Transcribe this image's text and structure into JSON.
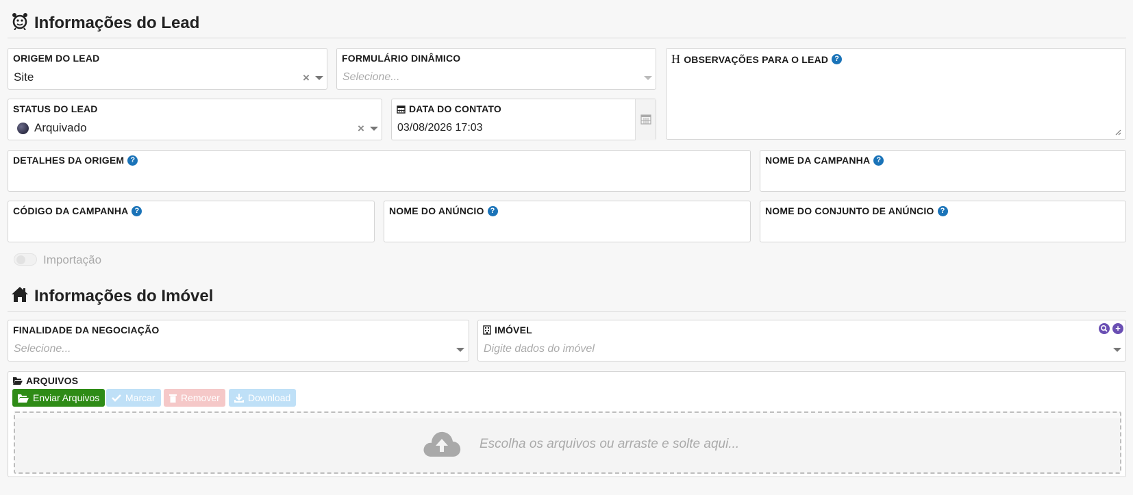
{
  "lead_section": {
    "title": "Informações do Lead",
    "origem": {
      "label": "ORIGEM DO LEAD",
      "value": "Site"
    },
    "formulario": {
      "label": "FORMULÁRIO DINÂMICO",
      "placeholder": "Selecione..."
    },
    "observacoes": {
      "label": "OBSERVAÇÕES PARA O LEAD",
      "prefix": "H"
    },
    "status": {
      "label": "STATUS DO LEAD",
      "value": "Arquivado"
    },
    "data_contato": {
      "label": "DATA DO CONTATO",
      "value": "03/08/2026 17:03"
    },
    "detalhes_origem": {
      "label": "DETALHES DA ORIGEM"
    },
    "nome_campanha": {
      "label": "NOME DA CAMPANHA"
    },
    "codigo_campanha": {
      "label": "CÓDIGO DA CAMPANHA"
    },
    "nome_anuncio": {
      "label": "NOME DO ANÚNCIO"
    },
    "nome_conjunto": {
      "label": "NOME DO CONJUNTO DE ANÚNCIO"
    },
    "importacao": {
      "label": "Importação",
      "checked": false
    }
  },
  "imovel_section": {
    "title": "Informações do Imóvel",
    "finalidade": {
      "label": "FINALIDADE DA NEGOCIAÇÃO",
      "placeholder": "Selecione..."
    },
    "imovel": {
      "label": "IMÓVEL",
      "placeholder": "Digite dados do imóvel"
    }
  },
  "arquivos": {
    "label": "ARQUIVOS",
    "buttons": {
      "enviar": "Enviar Arquivos",
      "marcar": "Marcar",
      "remover": "Remover",
      "download": "Download"
    },
    "dropzone_text": "Escolha os arquivos ou arraste e solte aqui..."
  },
  "help_glyph": "?",
  "colors": {
    "help": "#1a73b8",
    "enviar_button": "#2e8b16",
    "marcar_button": "#bfe0f7",
    "remover_button": "#f5c8c8",
    "download_button": "#bfe0f7",
    "imovel_icons": "#6a4fb3"
  }
}
